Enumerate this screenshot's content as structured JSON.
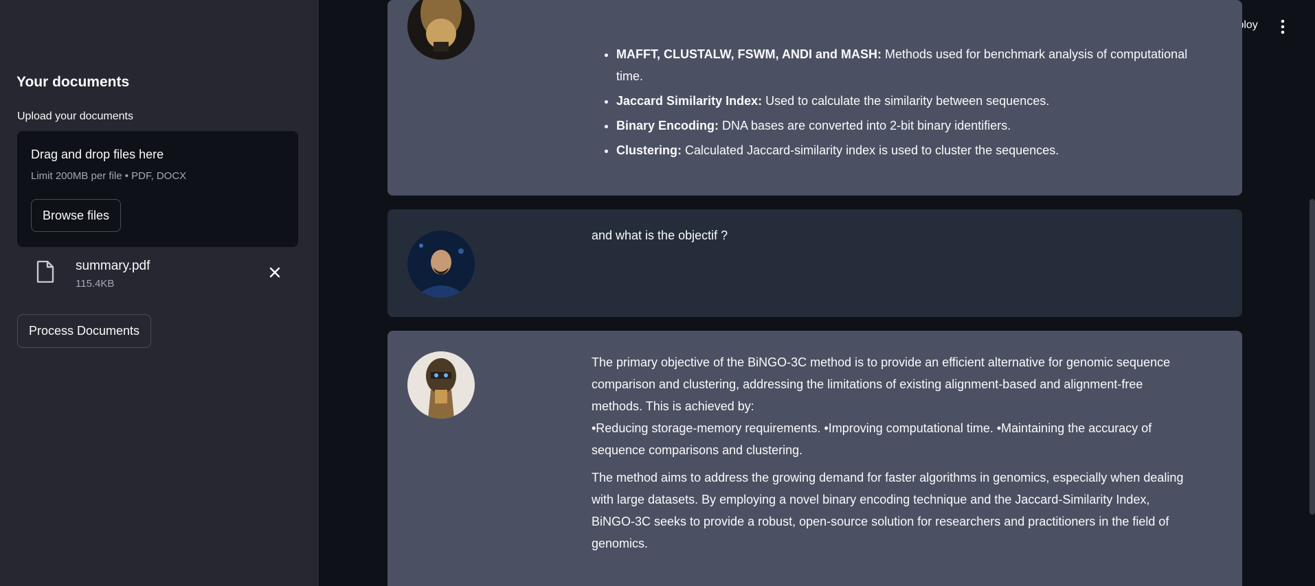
{
  "sidebar": {
    "title": "Your documents",
    "upload_label": "Upload your documents",
    "dropzone": {
      "title": "Drag and drop files here",
      "subtitle": "Limit 200MB per file • PDF, DOCX",
      "browse_label": "Browse files"
    },
    "file": {
      "name": "summary.pdf",
      "size": "115.4KB",
      "icon": "file-icon",
      "remove_icon": "close-icon"
    },
    "process_label": "Process Documents"
  },
  "header": {
    "deploy_label": "Deploy",
    "menu_icon": "more-vertical-icon"
  },
  "chat": {
    "message1": {
      "role": "assistant",
      "items": [
        {
          "bold": "MAFFT, CLUSTALW, FSWM, ANDI and MASH:",
          "text": " Methods used for benchmark analysis of computational time."
        },
        {
          "bold": "Jaccard Similarity Index:",
          "text": " Used to calculate the similarity between sequences."
        },
        {
          "bold": "Binary Encoding:",
          "text": " DNA bases are converted into 2-bit binary identifiers."
        },
        {
          "bold": "Clustering:",
          "text": " Calculated Jaccard-similarity index is used to cluster the sequences."
        }
      ]
    },
    "message2": {
      "role": "user",
      "text": "and what is the objectif ?"
    },
    "message3": {
      "role": "assistant",
      "para1_line1": "The primary objective of the BiNGO-3C method is to provide an efficient alternative for genomic sequence comparison and clustering, addressing the limitations of existing alignment-based and alignment-free methods. This is achieved by:",
      "para1_line2": "•Reducing storage-memory requirements. •Improving computational time. •Maintaining the accuracy of sequence comparisons and clustering.",
      "para2": "The method aims to address the growing demand for faster algorithms in genomics, especially when dealing with large datasets. By employing a novel binary encoding technique and the Jaccard-Similarity Index, BiNGO-3C seeks to provide a robust, open-source solution for researchers and practitioners in the field of genomics."
    }
  },
  "colors": {
    "background": "#0e1117",
    "sidebar": "#262730",
    "assistant_bubble": "#4b5163",
    "user_bubble": "#262d3a"
  }
}
